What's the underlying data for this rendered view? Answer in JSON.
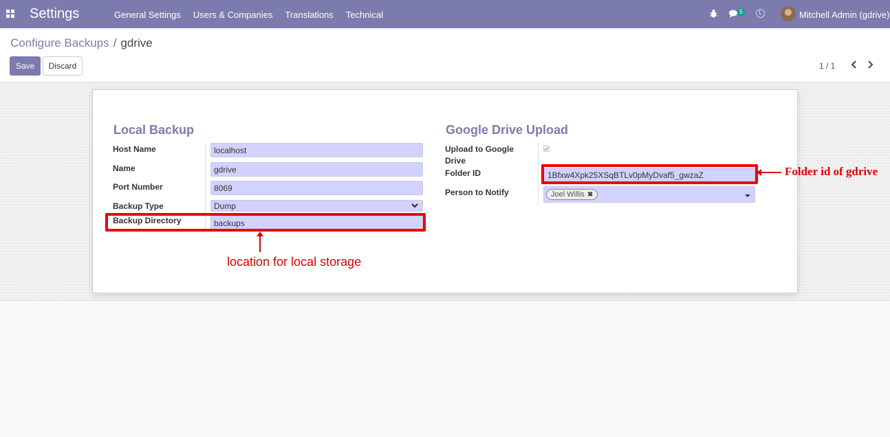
{
  "navbar": {
    "app_title": "Settings",
    "menu": [
      "General Settings",
      "Users & Companies",
      "Translations",
      "Technical"
    ],
    "chat_count": "5",
    "user_name": "Mitchell Admin (gdrive)"
  },
  "breadcrumb": {
    "parent": "Configure Backups",
    "separator": "/",
    "current": "gdrive"
  },
  "buttons": {
    "save": "Save",
    "discard": "Discard"
  },
  "pager": {
    "value": "1 / 1"
  },
  "local_backup": {
    "title": "Local Backup",
    "fields": {
      "host_name": {
        "label": "Host Name",
        "value": "localhost"
      },
      "name": {
        "label": "Name",
        "value": "gdrive"
      },
      "port_number": {
        "label": "Port Number",
        "value": "8069"
      },
      "backup_type": {
        "label": "Backup Type",
        "value": "Dump"
      },
      "backup_directory": {
        "label": "Backup Directory",
        "value": "backups"
      }
    }
  },
  "google_drive": {
    "title": "Google Drive Upload",
    "fields": {
      "upload": {
        "label_line1": "Upload to Google",
        "label_line2": "Drive",
        "checked": true
      },
      "folder_id": {
        "label": "Folder ID",
        "value": "1Bfxw4Xpk25XSqBTLv0pMyDvaf5_gwzaZ"
      },
      "person_to_notify": {
        "label": "Person to Notify",
        "tag": "Joel Willis"
      }
    }
  },
  "annotations": {
    "local_storage": "location for local storage",
    "folder_id": "Folder id of gdrive",
    "color": "#ee0000"
  },
  "colors": {
    "brand": "#7c7bad",
    "field_bg": "#d2d2ff",
    "badge": "#00a09d"
  }
}
